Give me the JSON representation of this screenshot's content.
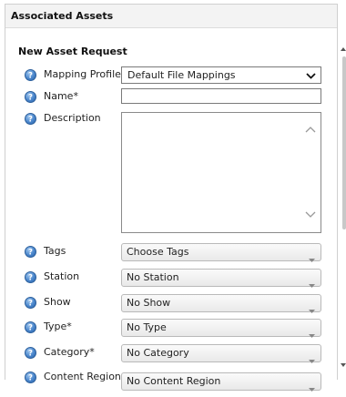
{
  "panel": {
    "title": "Associated Assets"
  },
  "form": {
    "section_title": "New Asset Request",
    "mapping_profile": {
      "label": "Mapping Profile",
      "value": "Default File Mappings"
    },
    "name": {
      "label": "Name*",
      "value": ""
    },
    "description": {
      "label": "Description",
      "value": ""
    },
    "tags": {
      "label": "Tags",
      "value": "Choose Tags"
    },
    "station": {
      "label": "Station",
      "value": "No Station"
    },
    "show": {
      "label": "Show",
      "value": "No Show"
    },
    "type": {
      "label": "Type*",
      "value": "No Type"
    },
    "category": {
      "label": "Category*",
      "value": "No Category"
    },
    "content_region": {
      "label": "Content Region",
      "value": "No Content Region"
    }
  },
  "icons": {
    "help": "help-question-icon",
    "select_chevron": "chevron-down-icon",
    "dropdown_arrow": "caret-down-icon"
  },
  "colors": {
    "help_icon": "#4a86cc",
    "panel_header_bg": "#f3f3f3"
  }
}
